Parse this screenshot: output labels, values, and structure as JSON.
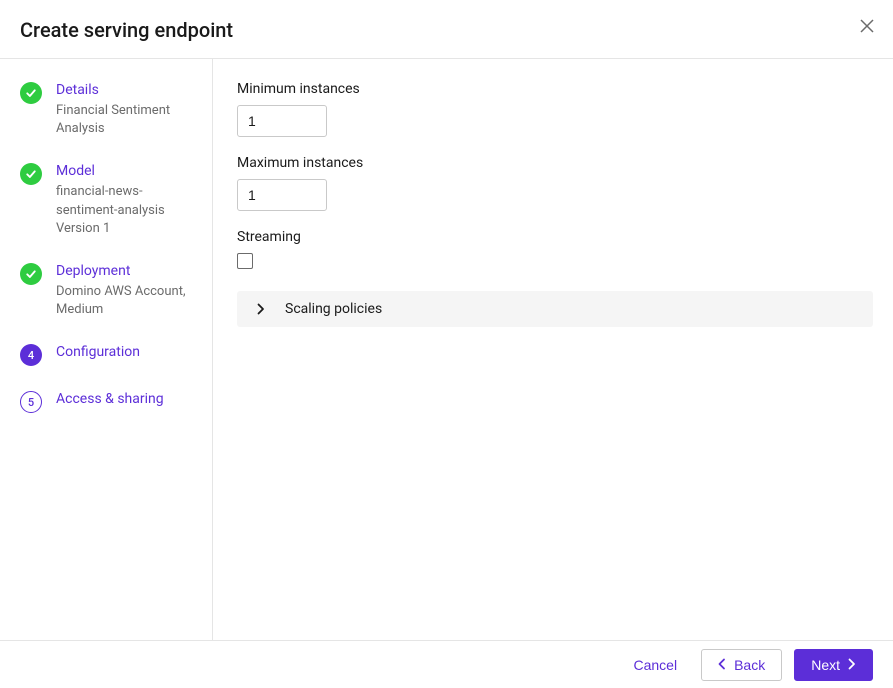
{
  "header": {
    "title": "Create serving endpoint"
  },
  "steps": [
    {
      "title": "Details",
      "subtitle": "Financial Sentiment Analysis",
      "state": "done"
    },
    {
      "title": "Model",
      "subtitle": "financial-news-sentiment-analysis Version 1",
      "state": "done"
    },
    {
      "title": "Deployment",
      "subtitle": "Domino AWS Account, Medium",
      "state": "done"
    },
    {
      "title": "Configuration",
      "subtitle": "",
      "state": "active",
      "number": "4"
    },
    {
      "title": "Access & sharing",
      "subtitle": "",
      "state": "pending",
      "number": "5"
    }
  ],
  "form": {
    "min_instances_label": "Minimum instances",
    "min_instances_value": "1",
    "max_instances_label": "Maximum instances",
    "max_instances_value": "1",
    "streaming_label": "Streaming",
    "streaming_checked": false,
    "scaling_policies_label": "Scaling policies"
  },
  "footer": {
    "cancel": "Cancel",
    "back": "Back",
    "next": "Next"
  }
}
